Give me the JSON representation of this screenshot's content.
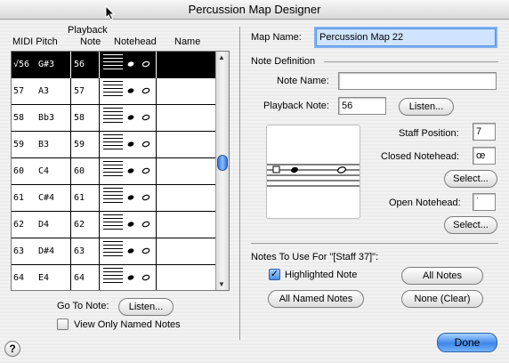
{
  "window": {
    "title": "Percussion Map Designer"
  },
  "table": {
    "headers": {
      "midi_pitch": "MIDI Pitch",
      "playback_top": "Playback",
      "playback_bottom": "Note",
      "notehead": "Notehead",
      "name": "Name"
    },
    "rows": [
      {
        "midi": "√56",
        "pitch": "G#3",
        "playback": "56",
        "selected": true
      },
      {
        "midi": "57",
        "pitch": "A3",
        "playback": "57",
        "selected": false
      },
      {
        "midi": "58",
        "pitch": "Bb3",
        "playback": "58",
        "selected": false
      },
      {
        "midi": "59",
        "pitch": "B3",
        "playback": "59",
        "selected": false
      },
      {
        "midi": "60",
        "pitch": "C4",
        "playback": "60",
        "selected": false
      },
      {
        "midi": "61",
        "pitch": "C#4",
        "playback": "61",
        "selected": false
      },
      {
        "midi": "62",
        "pitch": "D4",
        "playback": "62",
        "selected": false
      },
      {
        "midi": "63",
        "pitch": "D#4",
        "playback": "63",
        "selected": false
      },
      {
        "midi": "64",
        "pitch": "E4",
        "playback": "64",
        "selected": false
      }
    ]
  },
  "left": {
    "goto_label": "Go To Note:",
    "listen_label": "Listen...",
    "view_named_label": "View Only Named Notes"
  },
  "right": {
    "map_name_label": "Map Name:",
    "map_name_value": "Percussion Map 22",
    "note_definition_label": "Note Definition",
    "note_name_label": "Note Name:",
    "note_name_value": "",
    "playback_note_label": "Playback Note:",
    "playback_note_value": "56",
    "listen_label": "Listen...",
    "staff_position_label": "Staff Position:",
    "staff_position_value": "7",
    "closed_notehead_label": "Closed Notehead:",
    "closed_notehead_value": "œ",
    "select_label": "Select...",
    "open_notehead_label": "Open Notehead:",
    "open_notehead_value": "˙",
    "notes_to_use_label": "Notes To Use For \"[Staff 37]\":",
    "highlighted_note_label": "Highlighted Note",
    "all_notes_label": "All Notes",
    "all_named_notes_label": "All Named Notes",
    "none_clear_label": "None (Clear)",
    "done_label": "Done"
  },
  "icons": {
    "help": "?",
    "checkmark": "✓",
    "arrow_up": "▲",
    "arrow_down": "▼"
  }
}
